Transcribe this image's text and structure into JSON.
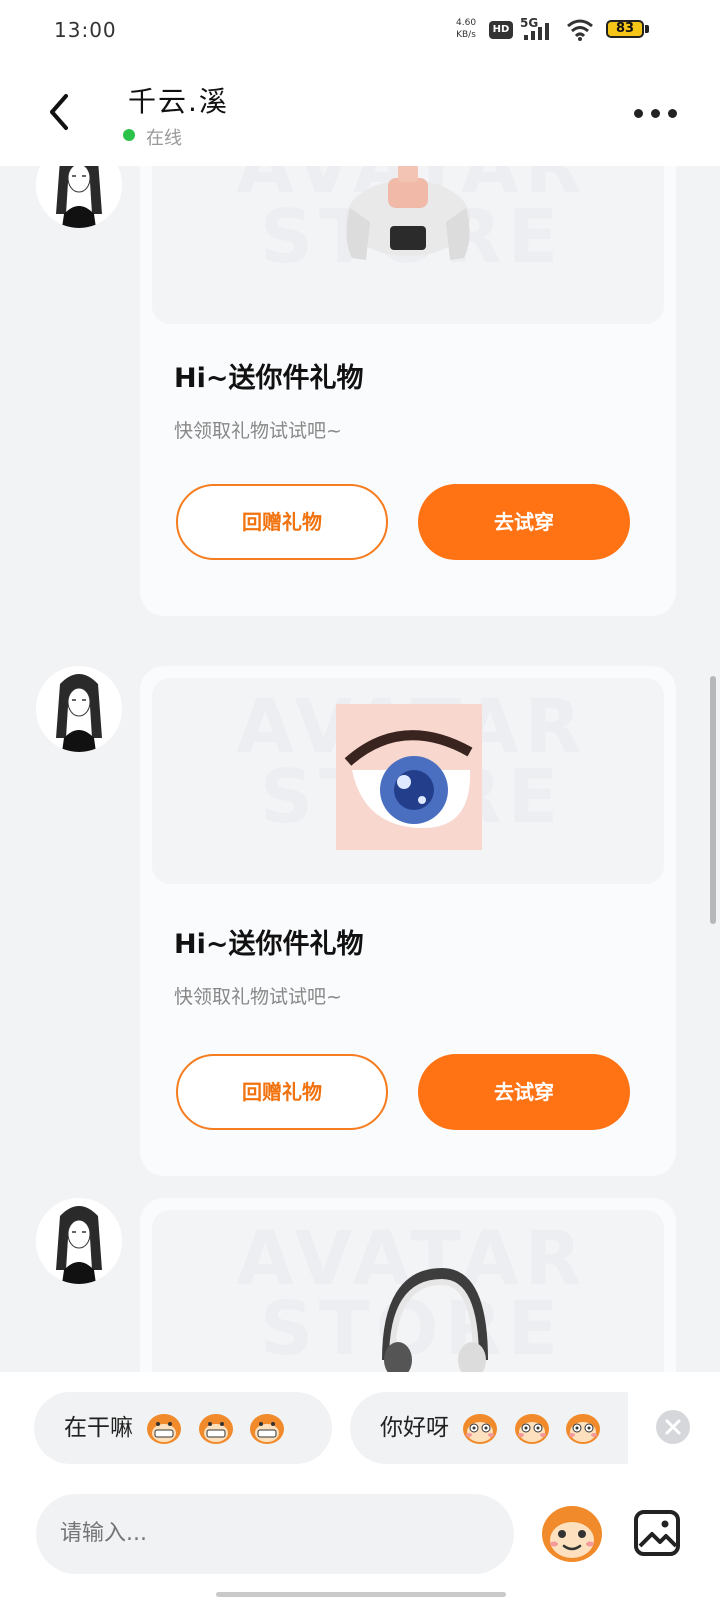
{
  "status_bar": {
    "time": "13:00",
    "net_speed_value": "4.60",
    "net_speed_unit": "KB/s",
    "hd_label": "HD",
    "signal_label": "5G",
    "battery_level": "83"
  },
  "header": {
    "title": "千云.溪",
    "status": "在线",
    "status_color": "#2bc24a"
  },
  "messages": [
    {
      "item": "cardigan-top",
      "card_title": "Hi~送你件礼物",
      "card_subtitle": "快领取礼物试试吧~",
      "return_gift_label": "回赠礼物",
      "try_on_label": "去试穿"
    },
    {
      "item": "anime-eye",
      "card_title": "Hi~送你件礼物",
      "card_subtitle": "快领取礼物试试吧~",
      "return_gift_label": "回赠礼物",
      "try_on_label": "去试穿"
    },
    {
      "item": "headphones"
    }
  ],
  "watermark": {
    "line1": "AVATAR",
    "line2": "STORE"
  },
  "quick_replies": [
    {
      "text": "在干嘛",
      "emoji_count": 3,
      "emoji": "grinning-monkey-icon"
    },
    {
      "text": "你好呀",
      "emoji_count": 3,
      "emoji": "blushing-monkey-icon"
    }
  ],
  "input": {
    "placeholder": "请输入..."
  },
  "colors": {
    "accent": "#ff7314",
    "background": "#f2f3f5",
    "card": "#fafbfc"
  }
}
